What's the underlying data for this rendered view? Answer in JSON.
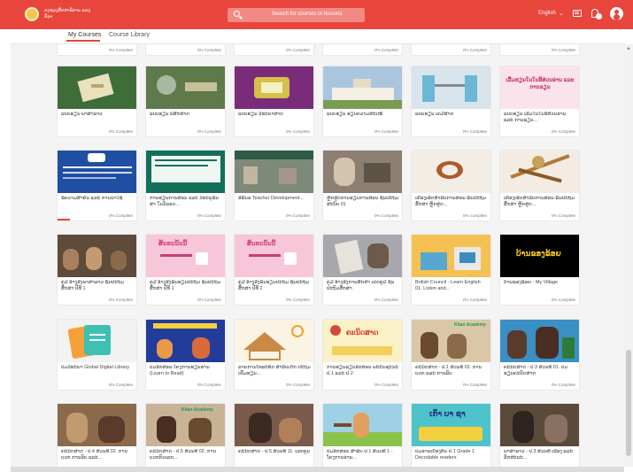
{
  "header": {
    "logo_text": "ກະຊວງສຶກສາທິການ ແລະ ກິລາ",
    "search_placeholder": "Search for courses or lessons",
    "language": "English",
    "brand_color": "#e8453c"
  },
  "tabs": [
    {
      "label": "My Courses",
      "active": true
    },
    {
      "label": "Course Library",
      "active": false
    }
  ],
  "status_label": "0% Complete",
  "thumb_labels": {
    "sign1": "ເລີ່ມຮຽນໃນໃນອີສ່ວນອ່ານ ແລະ ການຂຽນ",
    "ab1": "ສັ້ນອະນັ້ນນີ້",
    "ab2": "ສັ້ນອະນັ້ນນີ້",
    "khanacademy": "Khan Academy",
    "myvillage": "ບ້ານຂອງຂ້ອຍ",
    "book": "ຄະນິດສາດ",
    "kaobasa": "ເກົ່າ ບາ ຊາ"
  },
  "courses": [
    {
      "title": "ແບບຮຽນ ພາສາລາວ"
    },
    {
      "title": "ແບບຮຽນ ພິສິກສາດ"
    },
    {
      "title": "ແບບຮຽນ ວິທະຍາສາດ"
    },
    {
      "title": "ແບບຮຽນ ຮຽນຄວາມສະເໝີ"
    },
    {
      "title": "ແບບຮຽນ ເຄມີສາດ"
    },
    {
      "title": "ແບບຮຽນ ເລີ່ມໃນໃນອີສ່ວນອ່ານ ແລະ ການຂຽນ..."
    },
    {
      "title": "ຂໍ້ຄວາມສຳຄັນ ແລະ ການນຳໃຊ້"
    },
    {
      "title": "ການຮຽນການສອນ ແລະ ວິທະຍຸຂຶ້ນສາ ໃນວັລອດ..."
    },
    {
      "title": "ອີຣີນອ Teacher Development..."
    },
    {
      "title": "ຫຼັກສູດການຮຽນການສອນ ຊັ້ນປະຖົມ ສະບັບ 01"
    },
    {
      "title": "ເຄີ່ອງເຮັດສຳລັບການສອນ-ຂຶ້ນປະຖົມສຶກສາ ຫຼັກສູດ..."
    },
    {
      "title": "ເຄີ່ອງເຮັດສຳລັບການສອນ-ຂຶ້ນປະຖົມສຶກສາ ຫຼັກສູດ..."
    },
    {
      "title": "ຄູ່ມື ອ້າງອີງພາສາລາວ ຊັ້ນປະຖົມສຶກສາ ປີທີ 1"
    },
    {
      "title": "ຄູ່ມື ອ້າງອີງຂຶ້ນຮຽນປະຖົມ ຊັ້ນປະຖົມສຶກສາ ປີທີ 1"
    },
    {
      "title": "ຄູ່ມື ອ້າງອີງຂຶ້ນຮຽນປະຖົມ ຊັ້ນປະຖົມສຶກສາ ປີທີ 2"
    },
    {
      "title": "ຄູ່ມື ອ້າງອີງການສຶກສາ ເປີດຄູ່ມື ຊັ້ນປະຖົມສຶກສາ"
    },
    {
      "title": "British Council - Learn English 01. Listen and..."
    },
    {
      "title": "ບ້ານຂອງຂ້ອຍ - My Village"
    },
    {
      "title": "ປື້ມວິທະຍາ Global Digital Library"
    },
    {
      "title": "ປື້ມອັກສອນ-ໂຄງການຮຽນອ່ານ (Learn to Read)"
    },
    {
      "title": "ລາຍການໂທລະທັດ ສຳລັບເດັກ ປະຖົມ ເພີ່ມຮຽນ..."
    },
    {
      "title": "ການຮຽນຂຽນອັກສອນ ພະຍັນຊະນະ ປ.1 ແລະ ປ.2"
    },
    {
      "title": "ຄະນິດສາດ - ປ.1 ສ່ວນທີ 02. ການບວກ ແລະ ການລົບ"
    },
    {
      "title": "ຄະນິດສາດ - ປ.3 ສ່ວນທີ 01. ປື້ມຮຽນຄະນິດສາດ"
    },
    {
      "title": "ຄະນິດສາດ - ປ.4 ສ່ວນທີ 02. ການບວກ ການລົບ ແລະ..."
    },
    {
      "title": "ຄະນິດສາດ - ປ.5 ສ່ວນທີ 02. ການບວກຕົວເລກ..."
    },
    {
      "title": "ຄະນິດສາດ - ປ.5 ສ່ວນທີ 11. ເລກຄູນ"
    },
    {
      "title": "ປື້ມອັກສອນ ສຳລັບ ປ.1 ສ່ວນທີ 1 - ໂຄງການອ່ານ..."
    },
    {
      "title": "ປື້ມອ່ານເບື້ອງຕົ້ນ ປ.1 Grade 1 Decodable readers"
    },
    {
      "title": "ພາສາລາວ - ປ.3 ສ່ວນທີ ເລື່ອງ ແລະ ລັກສະນະ..."
    }
  ],
  "colors": {
    "background": "#f4f4f4",
    "card": "#ffffff",
    "progress": "#e8453c"
  }
}
